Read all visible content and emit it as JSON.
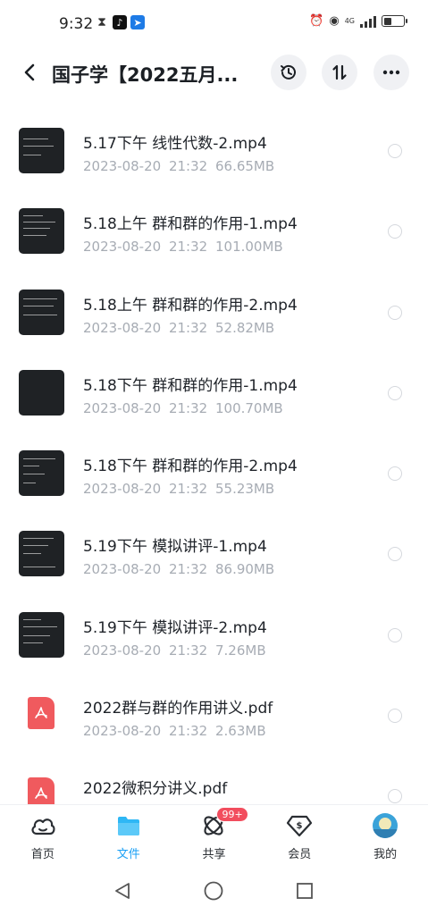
{
  "status_bar": {
    "time": "9:32",
    "network": "4G"
  },
  "header": {
    "title": "国子学【2022五月...",
    "back_icon": "chevron-left-icon",
    "history_icon": "history-clock-icon",
    "sort_icon": "sort-arrows-icon",
    "more_icon": "more-dots-icon"
  },
  "files": [
    {
      "name": "5.17下午 线性代数-2.mp4",
      "date": "2023-08-20",
      "time": "21:32",
      "size": "66.65MB",
      "type": "video"
    },
    {
      "name": "5.18上午 群和群的作用-1.mp4",
      "date": "2023-08-20",
      "time": "21:32",
      "size": "101.00MB",
      "type": "video"
    },
    {
      "name": "5.18上午 群和群的作用-2.mp4",
      "date": "2023-08-20",
      "time": "21:32",
      "size": "52.82MB",
      "type": "video"
    },
    {
      "name": "5.18下午 群和群的作用-1.mp4",
      "date": "2023-08-20",
      "time": "21:32",
      "size": "100.70MB",
      "type": "video"
    },
    {
      "name": "5.18下午 群和群的作用-2.mp4",
      "date": "2023-08-20",
      "time": "21:32",
      "size": "55.23MB",
      "type": "video"
    },
    {
      "name": "5.19下午 模拟讲评-1.mp4",
      "date": "2023-08-20",
      "time": "21:32",
      "size": "86.90MB",
      "type": "video"
    },
    {
      "name": "5.19下午 模拟讲评-2.mp4",
      "date": "2023-08-20",
      "time": "21:32",
      "size": "7.26MB",
      "type": "video"
    },
    {
      "name": "2022群与群的作用讲义.pdf",
      "date": "2023-08-20",
      "time": "21:32",
      "size": "2.63MB",
      "type": "pdf"
    },
    {
      "name": "2022微积分讲义.pdf",
      "date": "",
      "time": "",
      "size": "",
      "type": "pdf"
    }
  ],
  "tabs": [
    {
      "label": "首页",
      "icon": "home-cloud-icon",
      "active": false
    },
    {
      "label": "文件",
      "icon": "folder-icon",
      "active": true
    },
    {
      "label": "共享",
      "icon": "share-atom-icon",
      "active": false,
      "badge": "99+"
    },
    {
      "label": "会员",
      "icon": "vip-diamond-icon",
      "active": false
    },
    {
      "label": "我的",
      "icon": "avatar-icon",
      "active": false
    }
  ],
  "colors": {
    "accent": "#1aa0f5",
    "meta_text": "#a7acb4",
    "badge": "#f24d5e",
    "pdf": "#f05a5e"
  }
}
